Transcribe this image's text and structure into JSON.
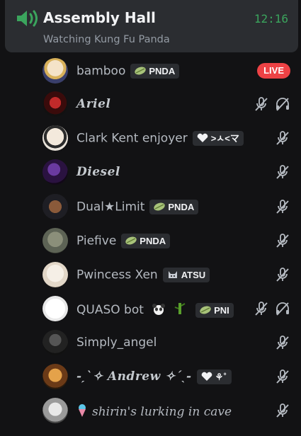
{
  "header": {
    "channel_name": "Assembly Hall",
    "time": "12:16",
    "activity": "Watching Kung Fu Panda",
    "icon": "voice-channel-speaker-icon"
  },
  "users": [
    {
      "name": "bamboo",
      "tag": "PNDA",
      "live_label": "LIVE",
      "icons": []
    },
    {
      "name": "Ariel",
      "icons": [
        "mute-icon",
        "deafen-icon"
      ]
    },
    {
      "name": "Clark Kent enjoyer",
      "tag": ">ㅅ<マ",
      "icons": [
        "mute-icon"
      ]
    },
    {
      "name": "Diesel",
      "icons": [
        "mute-icon"
      ]
    },
    {
      "name": "Dual★Limit",
      "tag": "PNDA",
      "icons": [
        "mute-icon"
      ]
    },
    {
      "name": "Piefive",
      "tag": "PNDA",
      "icons": [
        "mute-icon"
      ]
    },
    {
      "name": "Pwincess Xen",
      "tag": "ATSU",
      "icons": [
        "mute-icon"
      ]
    },
    {
      "name": "QUASO bot",
      "tag": "PNI",
      "icons": [
        "mute-icon",
        "deafen-icon"
      ]
    },
    {
      "name": "Simply_angel",
      "icons": [
        "mute-icon"
      ]
    },
    {
      "name": "-ˏˋ✧ Andrew ✧ˊˎ-",
      "tag": "⚘˚",
      "icons": [
        "mute-icon"
      ]
    },
    {
      "name": "shirin's lurking in cave",
      "icons": [
        "mute-icon"
      ]
    }
  ],
  "colors": {
    "live": "#ed4245",
    "clock": "#3ba55d",
    "speaker": "#3ba55d"
  }
}
